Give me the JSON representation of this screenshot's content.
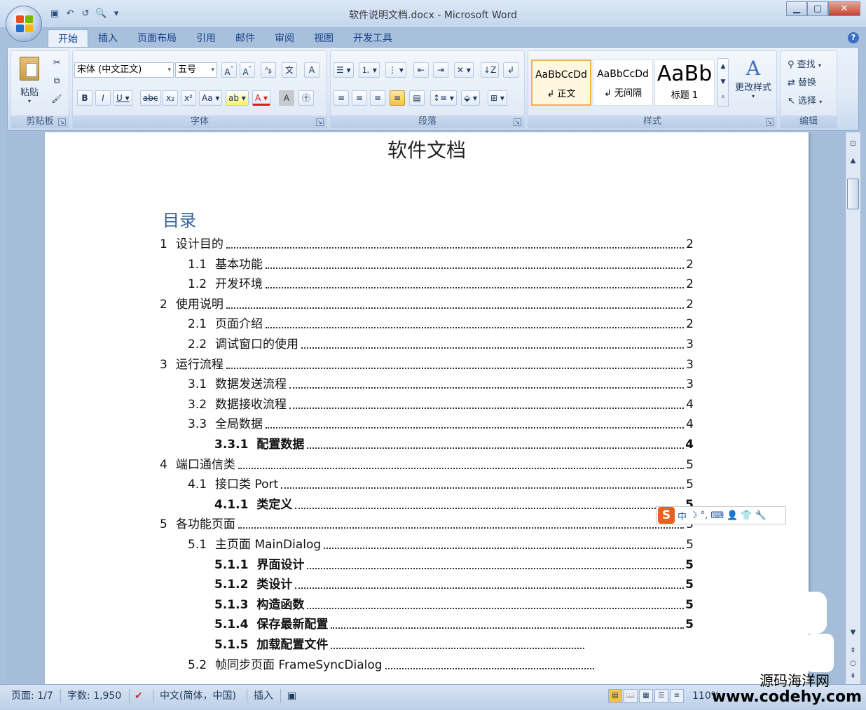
{
  "window": {
    "title": "软件说明文档.docx - Microsoft Word",
    "controls": {
      "minimize": "▁",
      "maximize": "▢",
      "close": "✕"
    }
  },
  "qat": {
    "save_icon": "▣",
    "undo_icon": "↶",
    "redo_icon": "↺",
    "print_preview_icon": "🔍",
    "customize_icon": "▾"
  },
  "tabs": [
    "开始",
    "插入",
    "页面布局",
    "引用",
    "邮件",
    "审阅",
    "视图",
    "开发工具"
  ],
  "ribbon": {
    "clipboard": {
      "paste_label": "粘贴",
      "group_label": "剪贴板"
    },
    "font": {
      "font_name": "宋体 (中文正文)",
      "font_size": "五号",
      "group_label": "字体",
      "buttons": [
        "B",
        "I",
        "U",
        "abc",
        "x₂",
        "x²",
        "Aa",
        "A",
        "A"
      ]
    },
    "paragraph": {
      "group_label": "段落"
    },
    "styles": {
      "group_label": "样式",
      "items": [
        {
          "sample": "AaBbCcDd",
          "name": "↲ 正文"
        },
        {
          "sample": "AaBbCcDd",
          "name": "↲ 无间隔"
        },
        {
          "sample": "AaBb",
          "name": "标题 1"
        }
      ],
      "change_styles_label": "更改样式"
    },
    "editing": {
      "group_label": "编辑",
      "find_label": "查找",
      "replace_label": "替换",
      "select_label": "选择"
    }
  },
  "document": {
    "title": "软件文档",
    "toc_heading": "目录",
    "toc": [
      {
        "num": "1",
        "text": "设计目的",
        "page": "2",
        "level": 1
      },
      {
        "num": "1.1",
        "text": "基本功能",
        "page": "2",
        "level": 2
      },
      {
        "num": "1.2",
        "text": "开发环境",
        "page": "2",
        "level": 2
      },
      {
        "num": "2",
        "text": "使用说明",
        "page": "2",
        "level": 1
      },
      {
        "num": "2.1",
        "text": "页面介绍",
        "page": "2",
        "level": 2
      },
      {
        "num": "2.2",
        "text": "调试窗口的使用",
        "page": "3",
        "level": 2
      },
      {
        "num": "3",
        "text": "运行流程",
        "page": "3",
        "level": 1
      },
      {
        "num": "3.1",
        "text": "数据发送流程",
        "page": "3",
        "level": 2
      },
      {
        "num": "3.2",
        "text": "数据接收流程",
        "page": "4",
        "level": 2
      },
      {
        "num": "3.3",
        "text": "全局数据",
        "page": "4",
        "level": 2
      },
      {
        "num": "3.3.1",
        "text": "配置数据",
        "page": "4",
        "level": 3
      },
      {
        "num": "4",
        "text": "端口通信类",
        "page": "5",
        "level": 1
      },
      {
        "num": "4.1",
        "text": "接口类 Port",
        "page": "5",
        "level": 2
      },
      {
        "num": "4.1.1",
        "text": "类定义",
        "page": "5",
        "level": 3
      },
      {
        "num": "5",
        "text": "各功能页面",
        "page": "5",
        "level": 1
      },
      {
        "num": "5.1",
        "text": "主页面 MainDialog",
        "page": "5",
        "level": 2
      },
      {
        "num": "5.1.1",
        "text": "界面设计",
        "page": "5",
        "level": 3
      },
      {
        "num": "5.1.2",
        "text": "类设计",
        "page": "5",
        "level": 3
      },
      {
        "num": "5.1.3",
        "text": "构造函数",
        "page": "5",
        "level": 3
      },
      {
        "num": "5.1.4",
        "text": "保存最新配置",
        "page": "5",
        "level": 3
      },
      {
        "num": "5.1.5",
        "text": "加载配置文件",
        "page": "",
        "level": 3
      },
      {
        "num": "5.2",
        "text": "帧同步页面 FrameSyncDialog",
        "page": "",
        "level": 2
      }
    ]
  },
  "ime": {
    "logo": "S",
    "mode": "中",
    "icons": [
      "☽",
      "°,",
      "⌨",
      "👤",
      "👕",
      "🔧"
    ]
  },
  "statusbar": {
    "page": "页面: 1/7",
    "words": "字数: 1,950",
    "language": "中文(简体，中国)",
    "insert_mode": "插入",
    "zoom": "110%"
  },
  "watermark": {
    "line1": "源码海洋网",
    "line2": "www.codehy.com"
  }
}
